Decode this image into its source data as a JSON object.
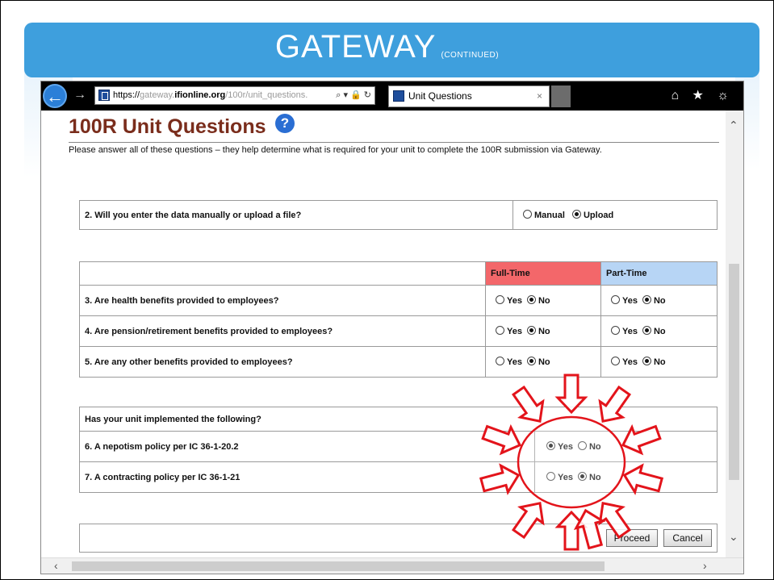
{
  "slide": {
    "title": "Gateway",
    "subtitle": "(Continued)"
  },
  "browser": {
    "url_prefix": "https://",
    "url_domain_plain": "gateway.",
    "url_domain_bold": "ifionline.org",
    "url_path": "/100r/unit_questions.",
    "url_controls": "⌕ ▾ 🔒 ↻",
    "tab_title": "Unit Questions",
    "tab_close": "×",
    "toolbar_icons": "⌂ ★ ☼"
  },
  "page": {
    "title": "100R Unit Questions",
    "help_symbol": "?",
    "intro": "Please answer all of these questions – they help determine what is required for your unit to complete the 100R submission via Gateway.",
    "q2": {
      "label": "2. Will you enter the data manually or upload a file?",
      "options": [
        "Manual",
        "Upload"
      ],
      "selected": "Upload"
    },
    "benefits": {
      "headers": {
        "full": "Full-Time",
        "part": "Part-Time"
      },
      "rows": [
        {
          "label": "3. Are health benefits provided to employees?",
          "full": "No",
          "part": "No"
        },
        {
          "label": "4. Are pension/retirement benefits provided to employees?",
          "full": "No",
          "part": "No"
        },
        {
          "label": "5. Are any other benefits provided to employees?",
          "full": "No",
          "part": "No"
        }
      ],
      "yes": "Yes",
      "no": "No"
    },
    "policies": {
      "heading": "Has your unit implemented the following?",
      "rows": [
        {
          "label": "6. A nepotism policy per IC 36-1-20.2",
          "selected": "Yes"
        },
        {
          "label": "7. A contracting policy per IC 36-1-21",
          "selected": "No"
        }
      ],
      "yes": "Yes",
      "no": "No"
    },
    "buttons": {
      "proceed": "Proceed",
      "cancel": "Cancel"
    }
  },
  "colors": {
    "banner": "#3e9fdd",
    "title_red": "#7a2d1c",
    "full_time_header": "#f3676a",
    "part_time_header": "#b7d5f5",
    "highlight_arrows": "#e3141b"
  }
}
